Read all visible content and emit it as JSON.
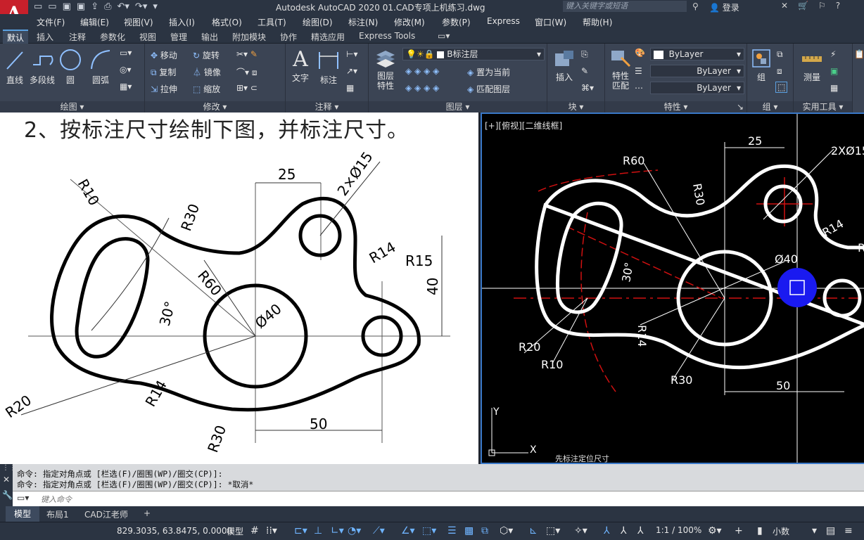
{
  "title_bar": {
    "app_title": "Autodesk AutoCAD 2020    01.CAD专项上机练习.dwg",
    "search_placeholder": "键入关键字或短语",
    "login": "登录"
  },
  "menu": [
    "文件(F)",
    "编辑(E)",
    "视图(V)",
    "插入(I)",
    "格式(O)",
    "工具(T)",
    "绘图(D)",
    "标注(N)",
    "修改(M)",
    "参数(P)",
    "Express",
    "窗口(W)",
    "帮助(H)"
  ],
  "ribbon_tabs": [
    "默认",
    "插入",
    "注释",
    "参数化",
    "视图",
    "管理",
    "输出",
    "附加模块",
    "协作",
    "精选应用",
    "Express Tools"
  ],
  "ribbon": {
    "draw": {
      "title": "绘图",
      "tools": [
        "直线",
        "多段线",
        "圆",
        "圆弧"
      ]
    },
    "modify": {
      "title": "修改",
      "tools": [
        "移动",
        "旋转",
        "复制",
        "镜像",
        "拉伸",
        "缩放"
      ]
    },
    "annotation": {
      "title": "注释",
      "tools": [
        "文字",
        "标注"
      ]
    },
    "layers": {
      "title": "图层",
      "layer_props": "图层\n特性",
      "current_layer": "B标注层",
      "set_current": "置为当前",
      "match_layer": "匹配图层"
    },
    "block": {
      "title": "块",
      "insert": "插入"
    },
    "properties": {
      "title": "特性",
      "match": "特性\n匹配",
      "color": "ByLayer",
      "linetype": "ByLayer",
      "lineweight": "ByLayer"
    },
    "groups": {
      "title": "组",
      "group": "组"
    },
    "utilities": {
      "title": "实用工具",
      "measure": "测量"
    }
  },
  "reference": {
    "heading": "2、按标注尺寸绘制下图，并标注尺寸。",
    "dims": [
      "25",
      "2×Ø15",
      "R10",
      "R30",
      "R60",
      "R14",
      "R15",
      "40",
      "Ø40",
      "30°",
      "R20",
      "R14",
      "R30",
      "50"
    ]
  },
  "viewport": {
    "label": "[+][俯视][二维线框]",
    "note": "先标注定位尺寸",
    "dims": [
      "R60",
      "25",
      "2XØ15",
      "R30",
      "R14",
      "Ø40",
      "30°",
      "R20",
      "R10",
      "R14",
      "R30",
      "50",
      "R"
    ],
    "ucs_x": "X",
    "ucs_y": "Y"
  },
  "command": {
    "history": [
      "命令: 指定对角点或 [栏选(F)/圈围(WP)/圈交(CP)]:",
      "命令: 指定对角点或 [栏选(F)/圈围(WP)/圈交(CP)]: *取消*"
    ],
    "placeholder": "键入命令"
  },
  "layout_tabs": [
    "模型",
    "布局1",
    "CAD江老师"
  ],
  "status": {
    "coords": "829.3035, 63.8475, 0.0000",
    "space": "模型",
    "scale": "1:1 / 100%",
    "units": "小数"
  }
}
